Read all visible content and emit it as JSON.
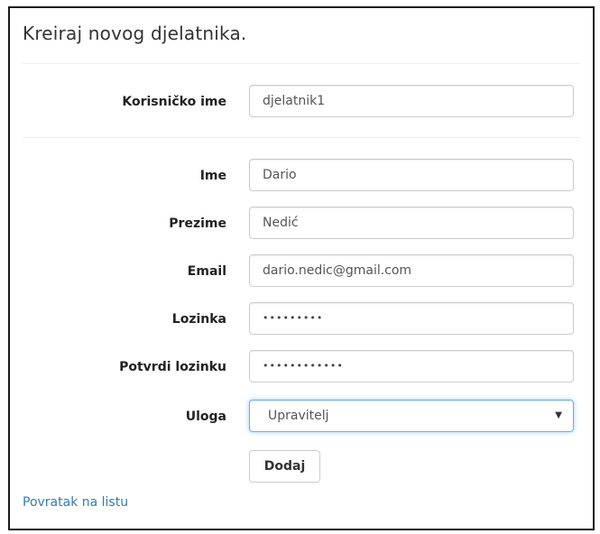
{
  "form": {
    "title": "Kreiraj novog djelatnika.",
    "username": {
      "label": "Korisničko ime",
      "value": "djelatnik1"
    },
    "first_name": {
      "label": "Ime",
      "value": "Dario"
    },
    "last_name": {
      "label": "Prezime",
      "value": "Nedić"
    },
    "email": {
      "label": "Email",
      "value": "dario.nedic@gmail.com"
    },
    "password": {
      "label": "Lozinka",
      "value": "•••••••••"
    },
    "confirm_password": {
      "label": "Potvrdi lozinku",
      "value": "••••••••••••"
    },
    "role": {
      "label": "Uloga",
      "selected": "Upravitelj",
      "caret": "▼"
    },
    "submit_label": "Dodaj",
    "back_link": "Povratak na listu"
  },
  "colors": {
    "link": "#337ab7",
    "focus_border": "#66afe9",
    "input_border": "#cccccc"
  }
}
